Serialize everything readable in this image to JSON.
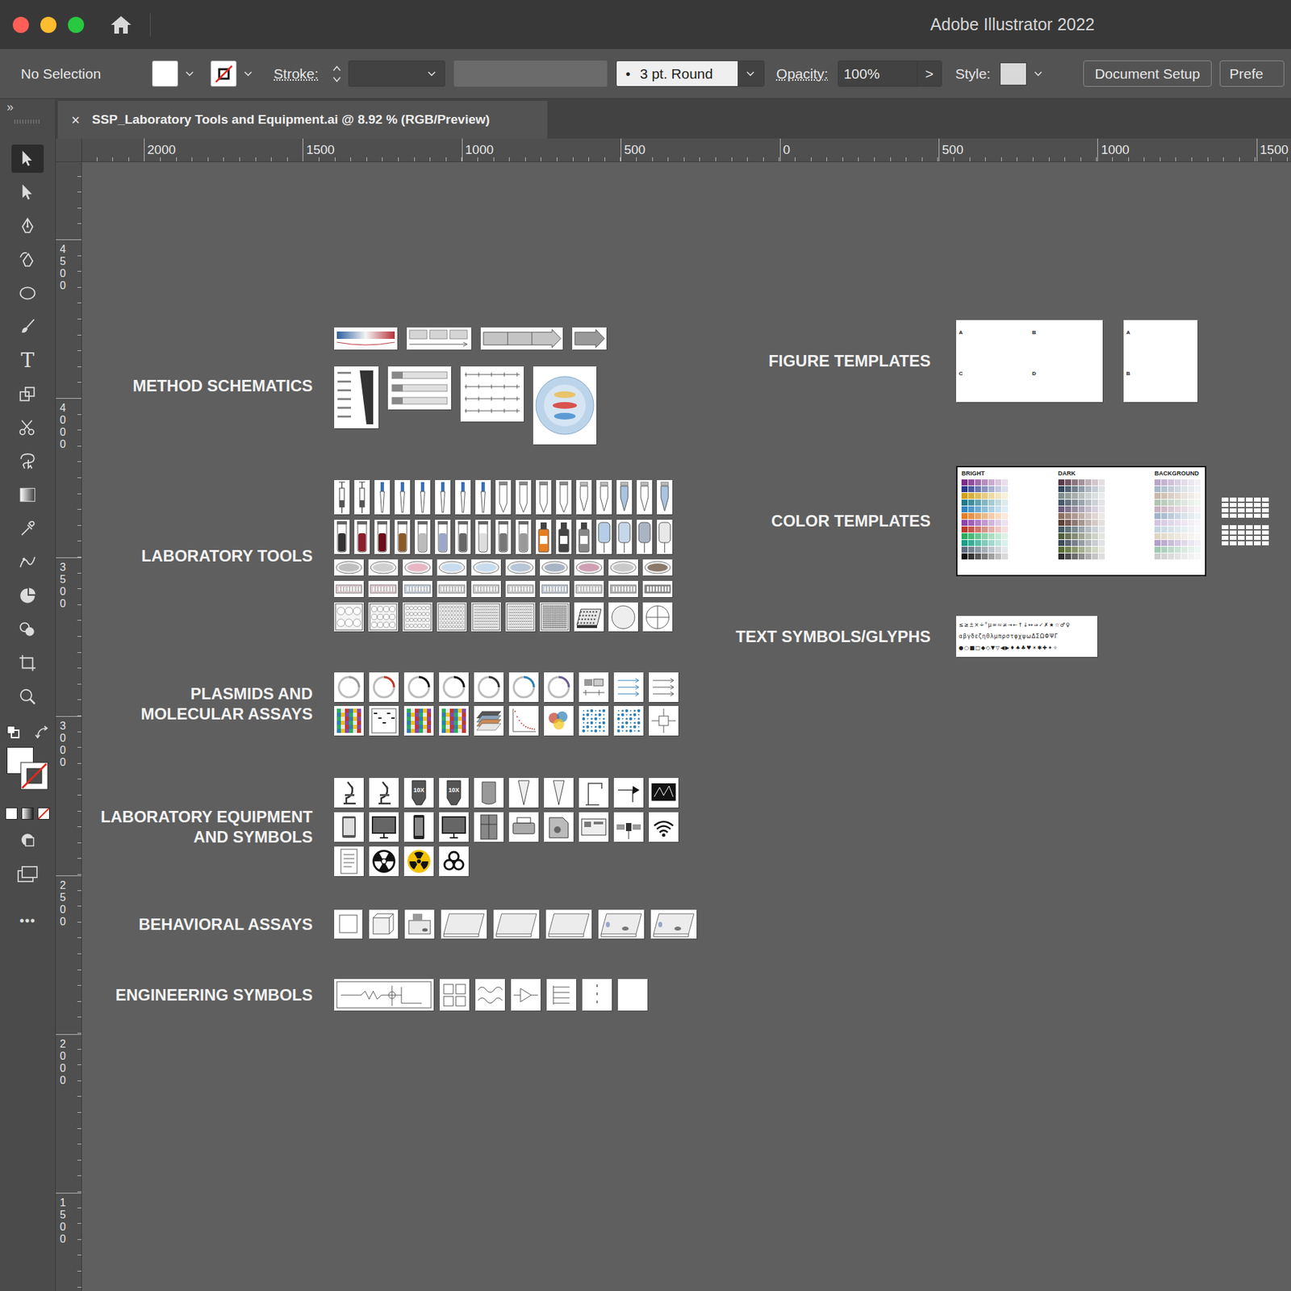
{
  "window": {
    "title": "Adobe Illustrator 2022"
  },
  "control_bar": {
    "selection": "No Selection",
    "stroke_label": "Stroke:",
    "brush_dot": "•",
    "brush": "3 pt. Round",
    "opacity_label": "Opacity:",
    "opacity": "100%",
    "opacity_more": ">",
    "style_label": "Style:",
    "buttons": [
      "Document Setup",
      "Prefe"
    ]
  },
  "panel_toggle": "»",
  "tabs": [
    {
      "close": "×",
      "label": "SSP_Laboratory Tools and Equipment.ai @ 8.92 % (RGB/Preview)",
      "selected": true
    }
  ],
  "tools": [
    {
      "kind": "select",
      "selected": true
    },
    {
      "kind": "direct",
      "selected": false
    },
    {
      "kind": "pen",
      "selected": false
    },
    {
      "kind": "curvature",
      "selected": false
    },
    {
      "kind": "ellipse",
      "selected": false
    },
    {
      "kind": "brush",
      "selected": false
    },
    {
      "kind": "type",
      "glyph": "T",
      "selected": false
    },
    {
      "kind": "scale",
      "selected": false
    },
    {
      "kind": "scissors",
      "selected": false
    },
    {
      "kind": "lasso",
      "selected": false
    },
    {
      "kind": "gradient",
      "selected": false
    },
    {
      "kind": "eyedropper",
      "selected": false
    },
    {
      "kind": "warp",
      "selected": false
    },
    {
      "kind": "pie",
      "selected": false
    },
    {
      "kind": "shapebuilder",
      "selected": false
    },
    {
      "kind": "artboard",
      "selected": false
    },
    {
      "kind": "zoom",
      "selected": false
    }
  ],
  "toolbar_more": "•••",
  "rulers": {
    "horizontal": [
      "2000",
      "1500",
      "1000",
      "500",
      "0",
      "500",
      "1000",
      "1500"
    ],
    "vertical": [
      "4500",
      "4000",
      "3500",
      "3000",
      "2500",
      "2000",
      "1500"
    ]
  },
  "sections": [
    {
      "label": [
        "METHOD SCHEMATICS"
      ],
      "rows": [
        [
          {
            "kind": "gradient"
          },
          {
            "kind": "timeline"
          },
          {
            "kind": "arrowbar"
          },
          {
            "kind": "arrow"
          }
        ],
        [
          {
            "kind": "ladder"
          },
          {
            "kind": "construct"
          },
          {
            "kind": "schedule"
          },
          {
            "kind": "cell"
          }
        ]
      ]
    },
    {
      "label": [
        "LABORATORY TOOLS"
      ],
      "rows": [
        [
          {
            "kind": "syringe"
          },
          {
            "kind": "syringe"
          },
          {
            "kind": "pipette"
          },
          {
            "kind": "pipette"
          },
          {
            "kind": "pipette"
          },
          {
            "kind": "pipette"
          },
          {
            "kind": "pipette"
          },
          {
            "kind": "pipette"
          },
          {
            "kind": "conical"
          },
          {
            "kind": "conical"
          },
          {
            "kind": "conical"
          },
          {
            "kind": "conical"
          },
          {
            "kind": "eppendorf",
            "color": "#ffffff"
          },
          {
            "kind": "eppendorf",
            "color": "#ffffff"
          },
          {
            "kind": "eppendorf",
            "color": "#a9c4e0"
          },
          {
            "kind": "eppendorf",
            "color": "#ffffff"
          },
          {
            "kind": "eppendorf",
            "color": "#a9c4e0"
          }
        ],
        [
          {
            "kind": "vial",
            "color": "#333333"
          },
          {
            "kind": "vial",
            "color": "#8b1e2d"
          },
          {
            "kind": "vial",
            "color": "#6b0f1a"
          },
          {
            "kind": "vial",
            "color": "#8a5a2b"
          },
          {
            "kind": "vial",
            "color": "#bbbbbb"
          },
          {
            "kind": "vial",
            "color": "#9aa7c7"
          },
          {
            "kind": "vial",
            "color": "#666666"
          },
          {
            "kind": "vial",
            "color": "#dddddd"
          },
          {
            "kind": "vial",
            "color": "#777777"
          },
          {
            "kind": "vial",
            "color": "#999999"
          },
          {
            "kind": "bottle",
            "color": "#e67e22"
          },
          {
            "kind": "bottle",
            "color": "#444444"
          },
          {
            "kind": "bottle",
            "color": "#888888"
          },
          {
            "kind": "bag",
            "color": "#b5cde6"
          },
          {
            "kind": "bag",
            "color": "#c7d7ea"
          },
          {
            "kind": "bag",
            "color": "#aab4c3"
          },
          {
            "kind": "bag",
            "color": "#e8e8e8"
          }
        ],
        [
          {
            "kind": "dish",
            "color": "#bfbfbf"
          },
          {
            "kind": "dish",
            "color": "#d0d0d0"
          },
          {
            "kind": "dish",
            "color": "#e8b7c3"
          },
          {
            "kind": "dish",
            "color": "#c9dcef"
          },
          {
            "kind": "dish",
            "color": "#c9dcef"
          },
          {
            "kind": "dish",
            "color": "#b7c6d8"
          },
          {
            "kind": "dish",
            "color": "#a8b3c4"
          },
          {
            "kind": "dish",
            "color": "#cfa0b4"
          },
          {
            "kind": "dish",
            "color": "#c9c9c9"
          },
          {
            "kind": "dish",
            "color": "#8b7a6b"
          }
        ],
        [
          {
            "kind": "strip",
            "color": "#f2d7dc"
          },
          {
            "kind": "strip",
            "color": "#f7d8de"
          },
          {
            "kind": "strip",
            "color": "#cfe2f3"
          },
          {
            "kind": "strip",
            "color": "#dddddd"
          },
          {
            "kind": "strip",
            "color": "#dddddd"
          },
          {
            "kind": "strip",
            "color": "#dddddd"
          },
          {
            "kind": "strip",
            "color": "#c9d7ea"
          },
          {
            "kind": "strip",
            "color": "#dddddd"
          },
          {
            "kind": "strip",
            "color": "#bbbbbb"
          },
          {
            "kind": "strip",
            "color": "#888888"
          }
        ],
        [
          {
            "kind": "plate-6"
          },
          {
            "kind": "plate-12"
          },
          {
            "kind": "plate-24"
          },
          {
            "kind": "plate-48"
          },
          {
            "kind": "plate-96"
          },
          {
            "kind": "plate-96"
          },
          {
            "kind": "plate-384"
          },
          {
            "kind": "plate-3d"
          },
          {
            "kind": "petri"
          },
          {
            "kind": "quadrant"
          }
        ]
      ]
    },
    {
      "label": [
        "PLASMIDS AND",
        "MOLECULAR ASSAYS"
      ],
      "rows": [
        [
          {
            "kind": "plasmid",
            "color": "#999999"
          },
          {
            "kind": "plasmid",
            "color": "#c0392b"
          },
          {
            "kind": "plasmid",
            "color": "#111111"
          },
          {
            "kind": "plasmid",
            "color": "#111111"
          },
          {
            "kind": "plasmid",
            "color": "#333333"
          },
          {
            "kind": "plasmid",
            "color": "#2c7fb8"
          },
          {
            "kind": "plasmid",
            "color": "#6b5b95"
          },
          {
            "kind": "map"
          },
          {
            "kind": "primer"
          },
          {
            "kind": "pcr"
          }
        ],
        [
          {
            "kind": "heatmap"
          },
          {
            "kind": "gel"
          },
          {
            "kind": "heatmap"
          },
          {
            "kind": "heatmap"
          },
          {
            "kind": "layers"
          },
          {
            "kind": "curve"
          },
          {
            "kind": "cloud"
          },
          {
            "kind": "dots"
          },
          {
            "kind": "dots"
          },
          {
            "kind": "network"
          }
        ]
      ]
    },
    {
      "label": [
        "LABORATORY EQUIPMENT",
        "AND SYMBOLS"
      ],
      "rows": [
        [
          {
            "kind": "microscope"
          },
          {
            "kind": "microscope"
          },
          {
            "kind": "objective",
            "text": "10X"
          },
          {
            "kind": "objective",
            "text": "10X"
          },
          {
            "kind": "canister"
          },
          {
            "kind": "cone"
          },
          {
            "kind": "cone"
          },
          {
            "kind": "stand"
          },
          {
            "kind": "pipe"
          },
          {
            "kind": "monitor-signal"
          }
        ],
        [
          {
            "kind": "tablet"
          },
          {
            "kind": "monitor"
          },
          {
            "kind": "phone"
          },
          {
            "kind": "monitor"
          },
          {
            "kind": "fridge"
          },
          {
            "kind": "printer"
          },
          {
            "kind": "machine"
          },
          {
            "kind": "device"
          },
          {
            "kind": "satellite"
          },
          {
            "kind": "wifi"
          }
        ],
        [
          {
            "kind": "doc"
          },
          {
            "kind": "radiation"
          },
          {
            "kind": "radiation-yellow"
          },
          {
            "kind": "biohazard"
          }
        ]
      ]
    },
    {
      "label": [
        "BEHAVIORAL ASSAYS"
      ],
      "rows": [
        [
          {
            "kind": "square-box"
          },
          {
            "kind": "cube-box"
          },
          {
            "kind": "cage"
          },
          {
            "kind": "open-field"
          },
          {
            "kind": "open-field"
          },
          {
            "kind": "open-field"
          },
          {
            "kind": "open-field-mouse"
          },
          {
            "kind": "open-field-mouse"
          }
        ]
      ]
    },
    {
      "label": [
        "ENGINEERING SYMBOLS"
      ],
      "rows": [
        [
          {
            "kind": "circuit"
          },
          {
            "kind": "panel"
          },
          {
            "kind": "wave"
          },
          {
            "kind": "amp"
          },
          {
            "kind": "lines"
          },
          {
            "kind": "dotline"
          },
          {
            "kind": "blank"
          }
        ]
      ]
    }
  ],
  "figure_templates": {
    "label": [
      "FIGURE TEMPLATES"
    ],
    "templates": [
      {
        "kind": "quad",
        "panels": [
          "A",
          "B",
          "C",
          "D"
        ]
      },
      {
        "kind": "pair",
        "panels": [
          "A",
          "B"
        ]
      }
    ]
  },
  "color_templates": {
    "label": [
      "COLOR TEMPLATES"
    ],
    "columns": [
      {
        "label": "BRIGHT",
        "rows": [
          "#7b2d8b",
          "#2b3a8f",
          "#d4a017",
          "#1f7a8c",
          "#2e86c1",
          "#e67e22",
          "#8e44ad",
          "#c0392b",
          "#27ae60",
          "#16a085",
          "#5d6d7e",
          "#111111"
        ]
      },
      {
        "label": "DARK",
        "rows": [
          "#5b3a4a",
          "#34495e",
          "#7f8c8d",
          "#4a5a6a",
          "#6c5b7b",
          "#8d6e63",
          "#5d4037",
          "#455a64",
          "#4e5d3a",
          "#3e4a5c",
          "#556b2f",
          "#2f2f2f"
        ]
      },
      {
        "label": "BACKGROUND",
        "rows": [
          "#b9a7c9",
          "#a9b8c9",
          "#c9b8a9",
          "#b0c4b1",
          "#c9b0c0",
          "#9fb3c8",
          "#d5c4e0",
          "#c4d5e0",
          "#e0d5c4",
          "#b3a0c9",
          "#a0c9b3",
          "#cccccc"
        ]
      }
    ]
  },
  "glyphs": {
    "label": [
      "TEXT SYMBOLS/GLYPHS"
    ],
    "lines": [
      "≤≥±×÷°µ∞≈≠→←↑↓↔⇒✓✗★☆♂♀",
      "αβγδεζηθλμπρστφχψωΔΣΩΦΨΓ",
      "●○■□◆◇▼▽◀▶♦♠♣♥☀✱✚✦✧"
    ]
  }
}
